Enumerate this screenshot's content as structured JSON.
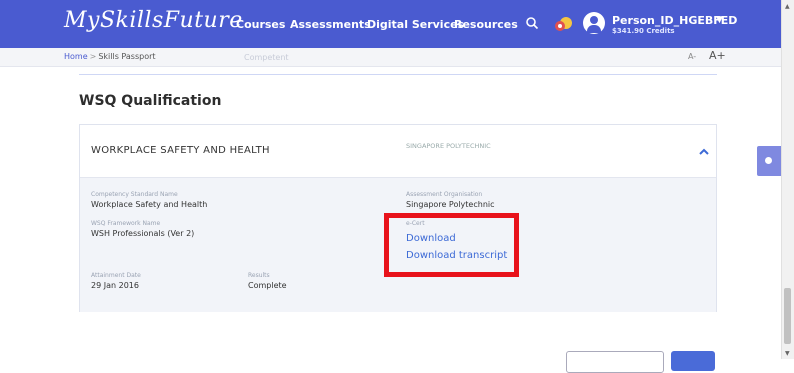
{
  "header": {
    "logo": "MySkillsFuture",
    "nav": [
      "Courses",
      "Assessments",
      "Digital Services",
      "Resources"
    ],
    "user_name": "Person_ID_HGEBFED",
    "user_credits": "$341.90 Credits"
  },
  "breadcrumb": {
    "home": "Home",
    "separator": ">",
    "current": "Skills Passport"
  },
  "faded_text": "Competent",
  "font_controls": {
    "smaller": "A-",
    "larger": "A+"
  },
  "section_title": "WSQ Qualification",
  "qualification": {
    "title": "WORKPLACE SAFETY AND HEALTH",
    "organisation_header": "SINGAPORE POLYTECHNIC",
    "competency_label": "Competency Standard Name",
    "competency_value": "Workplace Safety and Health",
    "framework_label": "WSQ Framework Name",
    "framework_value": "WSH Professionals (Ver 2)",
    "attainment_label": "Attainment Date",
    "attainment_value": "29 Jan 2016",
    "results_label": "Results",
    "results_value": "Complete",
    "org_label": "Assessment Organisation",
    "org_value": "Singapore Polytechnic",
    "ecert_label": "e-Cert",
    "download_link": "Download",
    "download_transcript_link": "Download transcript"
  },
  "colors": {
    "brand": "#4a5bd0",
    "highlight": "#e8121b",
    "link": "#3d6ad6"
  }
}
